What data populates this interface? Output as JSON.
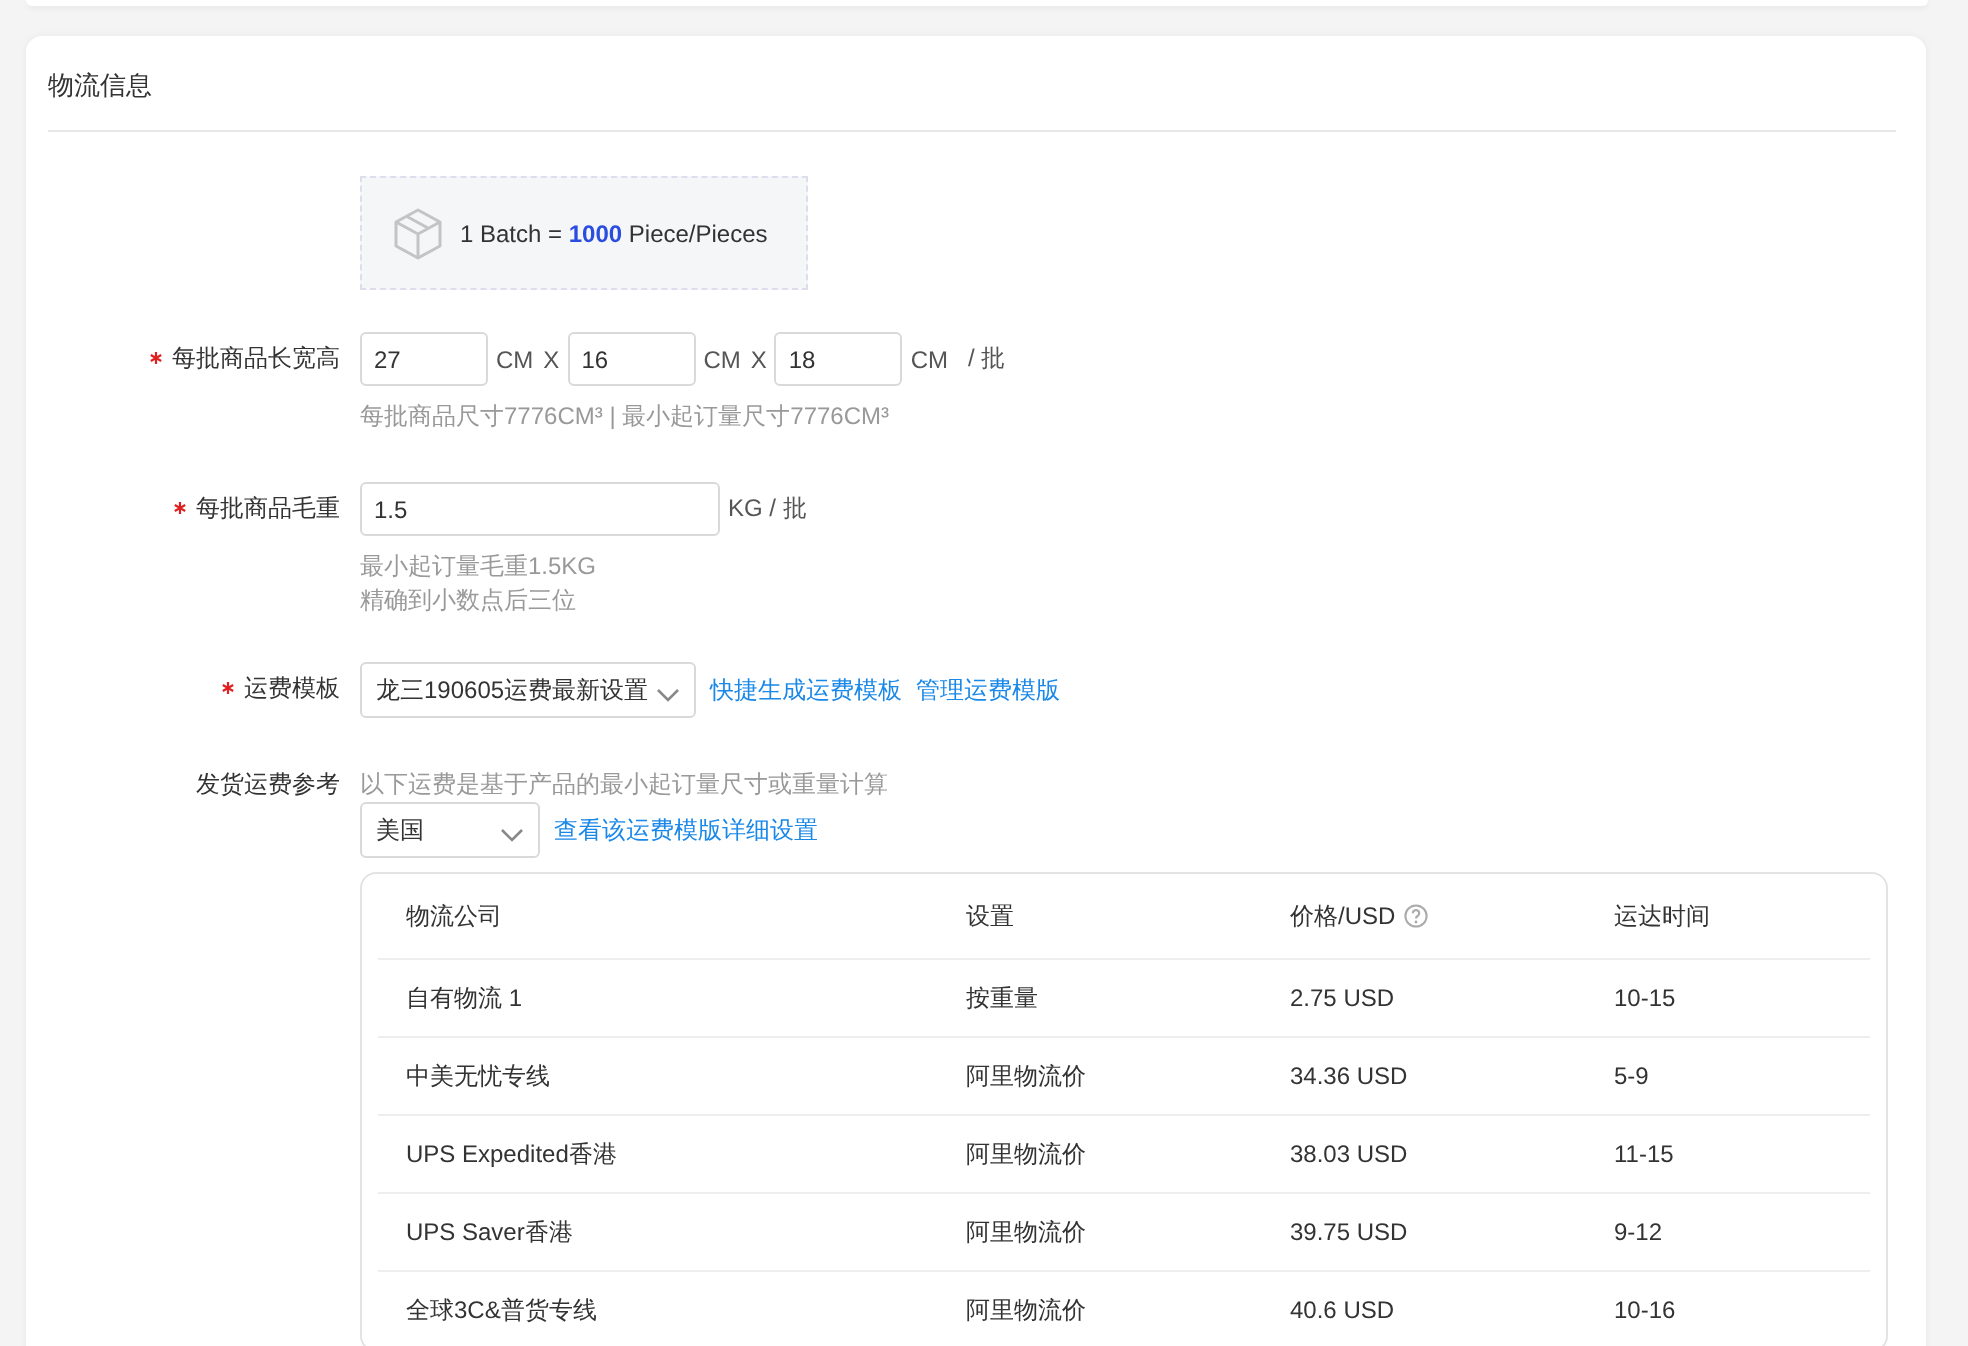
{
  "section": {
    "title": "物流信息"
  },
  "batch_info": {
    "text": "1 Batch = **1000** Piece/Pieces"
  },
  "dimensions": {
    "label": "每批商品长宽高",
    "required": true,
    "fields": [
      {
        "value": "27",
        "unit": "CM"
      },
      {
        "value": "16",
        "unit": "CM"
      },
      {
        "value": "18",
        "unit": "CM"
      }
    ],
    "separators": [
      "X",
      "X"
    ],
    "suffix": "/ 批",
    "hint": "每批商品尺寸7776CM³ | 最小起订量尺寸7776CM³"
  },
  "weight": {
    "label": "每批商品毛重",
    "required": true,
    "value": "1.5",
    "unit": "KG / 批",
    "hints": [
      "最小起订量毛重1.5KG",
      "精确到小数点后三位"
    ]
  },
  "shipping_template": {
    "label": "运费模板",
    "required": true,
    "value": "龙三190605运费最新设置",
    "links": [
      "快捷生成运费模板",
      "管理运费模版"
    ]
  },
  "shipping_reference": {
    "label": "发货运费参考",
    "required": false,
    "note": "以下运费是基于产品的最小起订量尺寸或重量计算",
    "country": "美国",
    "link": "查看该运费模版详细设置",
    "table": {
      "columns": [
        {
          "label": "物流公司",
          "kind": "plain"
        },
        {
          "label": "设置",
          "kind": "plain"
        },
        {
          "label": "价格/USD",
          "kind": "help"
        },
        {
          "label": "运达时间",
          "kind": "plain"
        }
      ],
      "rows": [
        [
          "自有物流 1",
          "按重量",
          "2.75 USD",
          "10-15"
        ],
        [
          "中美无忧专线",
          "阿里物流价",
          "34.36 USD",
          "5-9"
        ],
        [
          "UPS Expedited香港",
          "阿里物流价",
          "38.03 USD",
          "11-15"
        ],
        [
          "UPS Saver香港",
          "阿里物流价",
          "39.75 USD",
          "9-12"
        ],
        [
          "全球3C&普货专线",
          "阿里物流价",
          "40.6 USD",
          "10-16"
        ]
      ]
    }
  }
}
